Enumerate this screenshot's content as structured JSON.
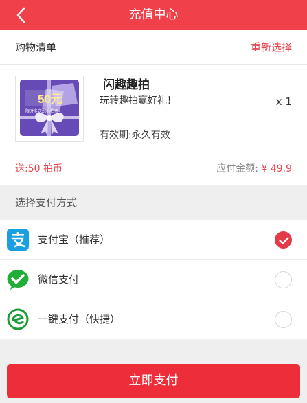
{
  "header": {
    "title": "充值中心"
  },
  "shopping_list": {
    "title": "购物清单",
    "reselect_label": "重新选择"
  },
  "product": {
    "name": "闪趣趣拍",
    "description": "玩转趣拍赢好礼！",
    "quantity": "x 1",
    "validity": "有效期:永久有效",
    "card": {
      "value": "50元",
      "note": "限时多送20%拍币"
    }
  },
  "summary": {
    "bonus": "送:50 拍币",
    "amount_label": "应付金额: ",
    "amount_value": "¥ 49.9"
  },
  "payment": {
    "section_title": "选择支付方式",
    "methods": [
      {
        "label": "支付宝（推荐）",
        "icon": "alipay-icon",
        "selected": true
      },
      {
        "label": "微信支付",
        "icon": "wechat-pay-icon",
        "selected": false
      },
      {
        "label": "一键支付（快捷）",
        "icon": "quick-pay-icon",
        "selected": false
      }
    ]
  },
  "pay_button": {
    "label": "立即支付"
  },
  "colors": {
    "brand": "#f0414a",
    "accent": "#e9434b",
    "button": "#ee2d3a",
    "alipay": "#1a9fe0",
    "wechat": "#22ac38",
    "quickpay": "#1d9b3a"
  }
}
